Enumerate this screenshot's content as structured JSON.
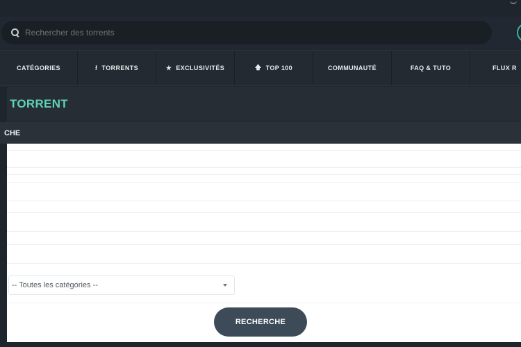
{
  "search": {
    "placeholder": "Rechercher des torrents"
  },
  "nav": {
    "items": [
      {
        "label": "CATÉGORIES",
        "icon": ""
      },
      {
        "label": "TORRENTS",
        "icon": "⭳"
      },
      {
        "label": "EXCLUSIVITÉS",
        "icon": "★"
      },
      {
        "label": "TOP 100",
        "icon": "🡅"
      },
      {
        "label": "COMMUNAUTÉ",
        "icon": ""
      },
      {
        "label": "FAQ & TUTO",
        "icon": ""
      },
      {
        "label": "FLUX R",
        "icon": ""
      }
    ]
  },
  "page": {
    "title": "TORRENT",
    "section": "CHE"
  },
  "form": {
    "category_select": "-- Toutes les catégories --",
    "submit_label": "RECHERCHE"
  },
  "colors": {
    "accent": "#5fd4b2",
    "button": "#3d4a58",
    "background": "#222831"
  }
}
